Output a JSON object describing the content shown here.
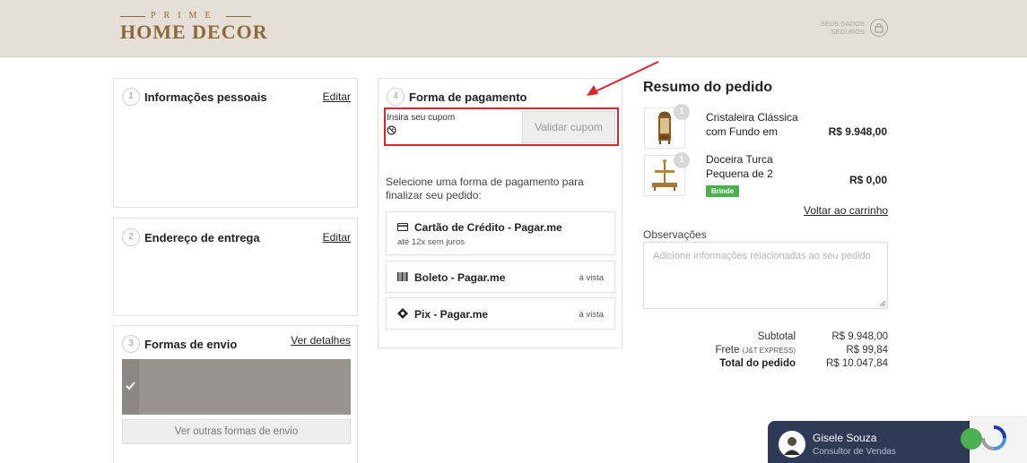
{
  "header": {
    "logo_top": "PRIME",
    "logo_main": "HOME DECOR",
    "secure_text": "SEUS DADOS SEGUROS",
    "icon": "lock-icon"
  },
  "steps": {
    "personal": {
      "number": "1",
      "title": "Informações pessoais",
      "link": "Editar"
    },
    "address": {
      "number": "2",
      "title": "Endereço de entrega",
      "link": "Editar"
    },
    "shipping": {
      "number": "3",
      "title": "Formas de envio",
      "link": "Ver detalhes",
      "more_button": "Ver outras formas de envio"
    },
    "payment": {
      "number": "4",
      "title": "Forma de pagamento",
      "coupon_label": "Insira seu cupom",
      "coupon_button": "Validar cupom",
      "prompt": "Selecione uma forma de pagamento para finalizar seu pedido:",
      "options": [
        {
          "name": "Cartão de Crédito - Pagar.me",
          "sub": "até 12x sem juros",
          "icon": "credit-card-icon"
        },
        {
          "name": "Boleto - Pagar.me",
          "right": "à vista",
          "icon": "barcode-icon"
        },
        {
          "name": "Pix - Pagar.me",
          "right": "à vista",
          "icon": "pix-icon"
        }
      ]
    }
  },
  "summary": {
    "title": "Resumo do pedido",
    "items": [
      {
        "qty": "1",
        "name": "Cristaleira Clássica com Fundo em",
        "price": "R$ 9.948,00"
      },
      {
        "qty": "1",
        "name": "Doceira Turca Pequena de 2",
        "price": "R$ 0,00",
        "badge": "Brinde"
      }
    ],
    "back_link": "Voltar ao carrinho",
    "notes_label": "Observações",
    "notes_placeholder": "Adicione informações relacionadas ao seu pedido",
    "subtotal_label": "Subtotal",
    "subtotal_value": "R$ 9.948,00",
    "shipping_label": "Frete",
    "shipping_carrier": "(J&T EXPRESS)",
    "shipping_value": "R$ 99,84",
    "total_label": "Total do pedido",
    "total_value": "R$ 10.047,84"
  },
  "chat": {
    "name": "Gisele Souza",
    "role": "Consultor de Vendas"
  },
  "colors": {
    "header_bg": "#e6dfd7",
    "gold": "#8a6a3a",
    "highlight_red": "#d9252b",
    "badge_green": "#4caf50",
    "chat_bg": "#2f3a56"
  }
}
